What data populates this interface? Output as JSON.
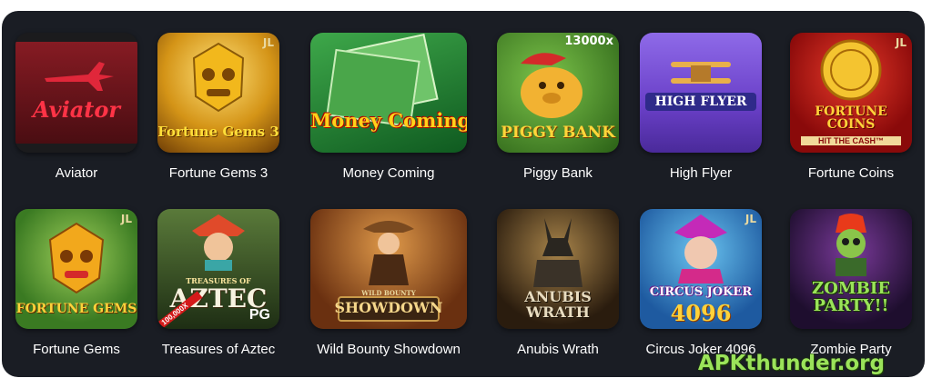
{
  "games": [
    {
      "name": "Aviator",
      "art_text": "Aviator",
      "colors": [
        "#8a1a22",
        "#3a0c10"
      ]
    },
    {
      "name": "Fortune Gems 3",
      "art_text": "Fortune Gems 3",
      "badge": "JL",
      "colors": [
        "#f4c542",
        "#b3700e"
      ]
    },
    {
      "name": "Money Coming",
      "art_text": "Money Coming",
      "colors": [
        "#2e8b3a",
        "#0f4a1a"
      ]
    },
    {
      "name": "Piggy Bank",
      "art_text": "PIGGY BANK",
      "badge": "13000x",
      "colors": [
        "#4a8a2a",
        "#1f4d12"
      ]
    },
    {
      "name": "High Flyer",
      "art_text": "HIGH FLYER",
      "colors": [
        "#8e68e6",
        "#5a34b8"
      ]
    },
    {
      "name": "Fortune Coins",
      "art_text": "FORTUNE COINS",
      "sub_text": "HIT THE CASH™",
      "badge": "JL",
      "colors": [
        "#c41616",
        "#6a0606"
      ]
    },
    {
      "name": "Fortune Gems",
      "art_text": "FORTUNE GEMS",
      "badge": "JL",
      "colors": [
        "#6fae3c",
        "#2d5e1a"
      ]
    },
    {
      "name": "Treasures of Aztec",
      "art_text": "AZTEC",
      "sub_text": "TREASURES OF",
      "tag": "PG",
      "corner": "100,000X",
      "colors": [
        "#3e6b2a",
        "#1a2f12"
      ]
    },
    {
      "name": "Wild Bounty Showdown",
      "art_text": "SHOWDOWN",
      "sub_text": "WILD BOUNTY",
      "colors": [
        "#b06a2a",
        "#4a2410"
      ]
    },
    {
      "name": "Anubis Wrath",
      "art_text": "ANUBIS WRATH",
      "colors": [
        "#8a6a3a",
        "#2a1e12"
      ]
    },
    {
      "name": "Circus Joker 4096",
      "art_text": "CIRCUS JOKER",
      "sub_text": "4096",
      "badge": "JL",
      "colors": [
        "#3a9ad8",
        "#1b4e8a"
      ]
    },
    {
      "name": "Zombie Party",
      "art_text": "ZOMBIE PARTY!!",
      "colors": [
        "#5a2a7a",
        "#1e0e2e"
      ]
    }
  ],
  "watermark": "APKthunder.org"
}
